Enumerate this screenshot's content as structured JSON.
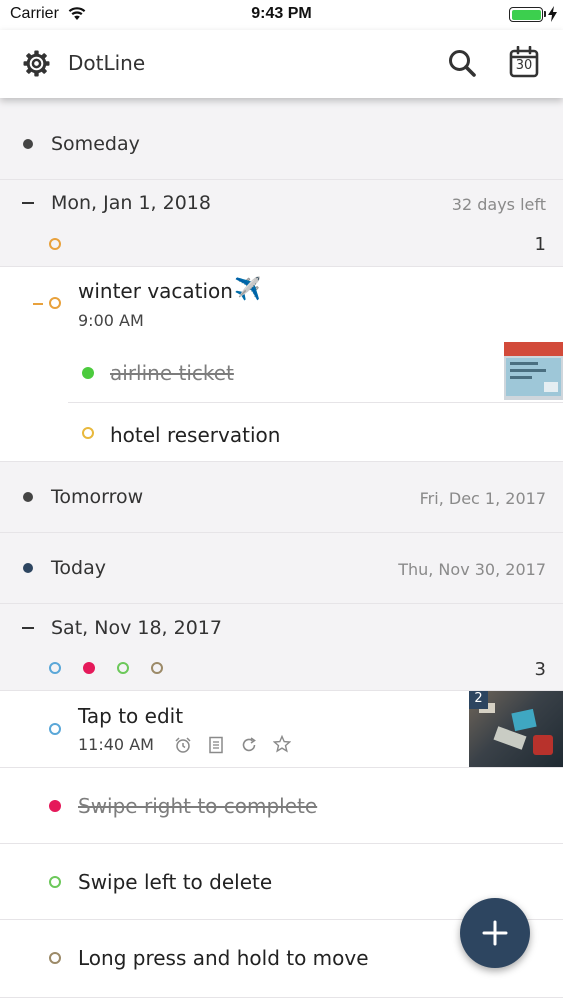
{
  "status_bar": {
    "carrier": "Carrier",
    "time": "9:43 PM"
  },
  "nav": {
    "title": "DotLine",
    "calendar_day": "30"
  },
  "groups": {
    "someday": {
      "label": "Someday"
    },
    "jan1": {
      "label": "Mon, Jan 1, 2018",
      "days_left": "32 days left",
      "count": "1"
    },
    "tomorrow": {
      "label": "Tomorrow",
      "date": "Fri, Dec 1, 2017"
    },
    "today": {
      "label": "Today",
      "date": "Thu, Nov 30, 2017"
    },
    "nov18": {
      "label": "Sat, Nov 18, 2017",
      "count": "3"
    }
  },
  "items": {
    "winter": {
      "title": "winter vacation",
      "emoji": "✈️",
      "time": "9:00 AM"
    },
    "airline": {
      "title": "airline ticket"
    },
    "hotel": {
      "title": "hotel reservation"
    },
    "tap": {
      "title": "Tap to edit",
      "time": "11:40 AM",
      "image_count": "2"
    },
    "swipe_right": {
      "title": "Swipe right to complete"
    },
    "swipe_left": {
      "title": "Swipe left to delete"
    },
    "long_press": {
      "title": "Long press and hold to move"
    }
  },
  "colors": {
    "orange": "#e8a13c",
    "yellow": "#e8b83c",
    "green": "#4ccb3e",
    "blue": "#5aa7d8",
    "pink": "#e5195a",
    "light_green": "#6cc85a",
    "brown": "#9c8a68",
    "dark_bullet": "#444444",
    "navy_bullet": "#2d4560",
    "fab": "#2d4560"
  },
  "icons": [
    "gear-icon",
    "search-icon",
    "calendar-icon",
    "alarm-icon",
    "note-icon",
    "repeat-icon",
    "star-icon",
    "plus-icon"
  ]
}
